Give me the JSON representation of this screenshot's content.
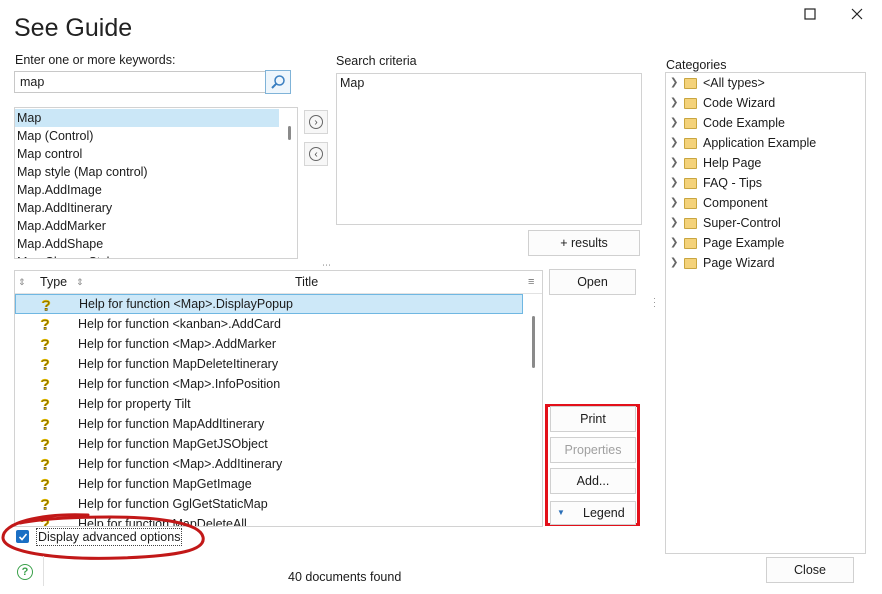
{
  "window": {
    "title": "See Guide"
  },
  "search": {
    "label": "Enter one or more keywords:",
    "value": "map"
  },
  "keywords": [
    "Map",
    "Map (Control)",
    "Map control",
    "Map style (Map control)",
    "Map.AddImage",
    "Map.AddItinerary",
    "Map.AddMarker",
    "Map.AddShape",
    "Map.ChangeStyle"
  ],
  "criteria": {
    "label": "Search criteria",
    "value": "Map"
  },
  "buttons": {
    "results": "+ results",
    "open": "Open",
    "print": "Print",
    "properties": "Properties",
    "add": "Add...",
    "legend": "Legend",
    "close": "Close"
  },
  "categories": {
    "label": "Categories",
    "items": [
      "<All types>",
      "Code Wizard",
      "Code Example",
      "Application Example",
      "Help Page",
      "FAQ - Tips",
      "Component",
      "Super-Control",
      "Page Example",
      "Page Wizard"
    ]
  },
  "results": {
    "headers": {
      "type": "Type",
      "title": "Title"
    },
    "rows": [
      "Help for function <Map>.DisplayPopup",
      "Help for function <kanban>.AddCard",
      "Help for function <Map>.AddMarker",
      "Help for function MapDeleteItinerary",
      "Help for function <Map>.InfoPosition",
      "Help for property Tilt",
      "Help for function MapAddItinerary",
      "Help for function MapGetJSObject",
      "Help for function <Map>.AddItinerary",
      "Help for function MapGetImage",
      "Help for function GglGetStaticMap",
      "Help for function MapDeleteAll"
    ]
  },
  "options": {
    "advanced_label": "Display advanced options",
    "advanced_checked": true
  },
  "status": {
    "found": "40 documents found"
  },
  "colors": {
    "highlight_red": "#e3101a",
    "selection": "#cde8f8",
    "checkbox": "#1a6fc4"
  }
}
